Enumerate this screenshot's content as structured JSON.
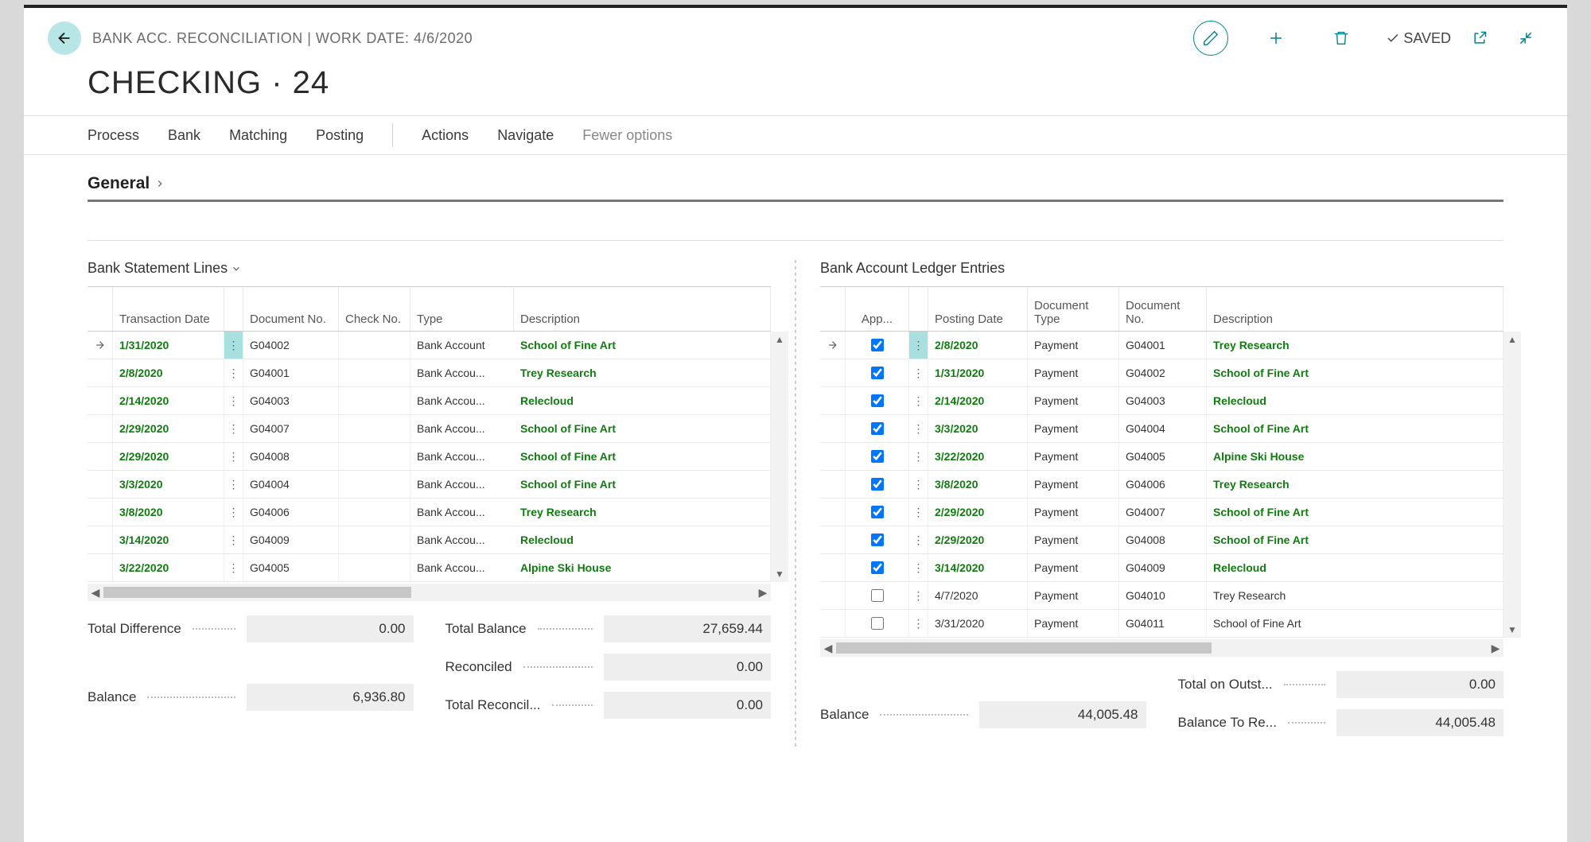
{
  "header": {
    "breadcrumb": "BANK ACC. RECONCILIATION | WORK DATE: 4/6/2020",
    "saved": "SAVED"
  },
  "title": "CHECKING · 24",
  "tabs": {
    "process": "Process",
    "bank": "Bank",
    "matching": "Matching",
    "posting": "Posting",
    "actions": "Actions",
    "navigate": "Navigate",
    "fewer": "Fewer options"
  },
  "section_general": "General",
  "left": {
    "title": "Bank Statement Lines",
    "cols": {
      "trans_date": "Transaction Date",
      "doc_no": "Document No.",
      "check_no": "Check No.",
      "type": "Type",
      "desc": "Description"
    },
    "rows": [
      {
        "date": "1/31/2020",
        "doc": "G04002",
        "type": "Bank Account",
        "desc": "School of Fine Art",
        "sel": true
      },
      {
        "date": "2/8/2020",
        "doc": "G04001",
        "type": "Bank Accou...",
        "desc": "Trey Research",
        "sel": false
      },
      {
        "date": "2/14/2020",
        "doc": "G04003",
        "type": "Bank Accou...",
        "desc": "Relecloud",
        "sel": false
      },
      {
        "date": "2/29/2020",
        "doc": "G04007",
        "type": "Bank Accou...",
        "desc": "School of Fine Art",
        "sel": false
      },
      {
        "date": "2/29/2020",
        "doc": "G04008",
        "type": "Bank Accou...",
        "desc": "School of Fine Art",
        "sel": false
      },
      {
        "date": "3/3/2020",
        "doc": "G04004",
        "type": "Bank Accou...",
        "desc": "School of Fine Art",
        "sel": false
      },
      {
        "date": "3/8/2020",
        "doc": "G04006",
        "type": "Bank Accou...",
        "desc": "Trey Research",
        "sel": false
      },
      {
        "date": "3/14/2020",
        "doc": "G04009",
        "type": "Bank Accou...",
        "desc": "Relecloud",
        "sel": false
      },
      {
        "date": "3/22/2020",
        "doc": "G04005",
        "type": "Bank Accou...",
        "desc": "Alpine Ski House",
        "sel": false
      }
    ],
    "totals": {
      "total_difference": {
        "label": "Total Difference",
        "value": "0.00"
      },
      "balance": {
        "label": "Balance",
        "value": "6,936.80"
      },
      "total_balance": {
        "label": "Total Balance",
        "value": "27,659.44"
      },
      "reconciled": {
        "label": "Reconciled",
        "value": "0.00"
      },
      "total_reconcil": {
        "label": "Total Reconcil...",
        "value": "0.00"
      }
    }
  },
  "right": {
    "title": "Bank Account Ledger Entries",
    "cols": {
      "app": "App...",
      "post_date": "Posting Date",
      "doc_type": "Document Type",
      "doc_no": "Document No.",
      "desc": "Description"
    },
    "rows": [
      {
        "app": true,
        "pdate": "2/8/2020",
        "dtype": "Payment",
        "dno": "G04001",
        "desc": "Trey Research",
        "m": true,
        "sel": true
      },
      {
        "app": true,
        "pdate": "1/31/2020",
        "dtype": "Payment",
        "dno": "G04002",
        "desc": "School of Fine Art",
        "m": true,
        "sel": false
      },
      {
        "app": true,
        "pdate": "2/14/2020",
        "dtype": "Payment",
        "dno": "G04003",
        "desc": "Relecloud",
        "m": true,
        "sel": false
      },
      {
        "app": true,
        "pdate": "3/3/2020",
        "dtype": "Payment",
        "dno": "G04004",
        "desc": "School of Fine Art",
        "m": true,
        "sel": false
      },
      {
        "app": true,
        "pdate": "3/22/2020",
        "dtype": "Payment",
        "dno": "G04005",
        "desc": "Alpine Ski House",
        "m": true,
        "sel": false
      },
      {
        "app": true,
        "pdate": "3/8/2020",
        "dtype": "Payment",
        "dno": "G04006",
        "desc": "Trey Research",
        "m": true,
        "sel": false
      },
      {
        "app": true,
        "pdate": "2/29/2020",
        "dtype": "Payment",
        "dno": "G04007",
        "desc": "School of Fine Art",
        "m": true,
        "sel": false
      },
      {
        "app": true,
        "pdate": "2/29/2020",
        "dtype": "Payment",
        "dno": "G04008",
        "desc": "School of Fine Art",
        "m": true,
        "sel": false
      },
      {
        "app": true,
        "pdate": "3/14/2020",
        "dtype": "Payment",
        "dno": "G04009",
        "desc": "Relecloud",
        "m": true,
        "sel": false
      },
      {
        "app": false,
        "pdate": "4/7/2020",
        "dtype": "Payment",
        "dno": "G04010",
        "desc": "Trey Research",
        "m": false,
        "sel": false
      },
      {
        "app": false,
        "pdate": "3/31/2020",
        "dtype": "Payment",
        "dno": "G04011",
        "desc": "School of Fine Art",
        "m": false,
        "sel": false
      }
    ],
    "totals": {
      "balance": {
        "label": "Balance",
        "value": "44,005.48"
      },
      "total_on_outst": {
        "label": "Total on Outst...",
        "value": "0.00"
      },
      "balance_to_re": {
        "label": "Balance To Re...",
        "value": "44,005.48"
      }
    }
  }
}
